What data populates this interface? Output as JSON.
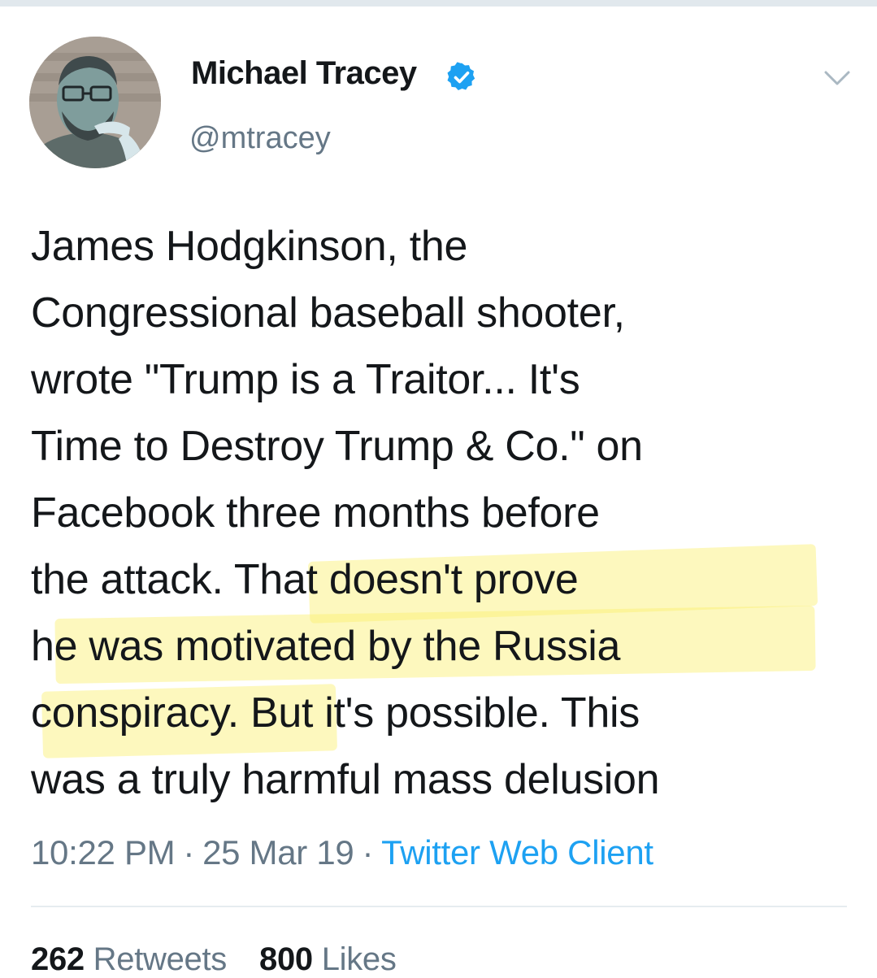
{
  "author": {
    "display_name": "Michael Tracey",
    "handle": "@mtracey",
    "verified": true,
    "verified_color": "#1da1f2"
  },
  "tweet": {
    "lines": [
      "James Hodgkinson, the",
      "Congressional baseball shooter,",
      "wrote \"Trump is a Traitor... It's",
      "Time to Destroy Trump & Co.\" on",
      "Facebook three months before",
      "the attack. That doesn't prove",
      "he was motivated by the Russia",
      "conspiracy. But it's possible. This",
      "was a truly harmful mass delusion"
    ],
    "highlight_color": "#faf06e"
  },
  "meta": {
    "time": "10:22 PM",
    "separator": "·",
    "date": "25 Mar 19",
    "source": "Twitter Web Client",
    "source_color": "#1da1f2"
  },
  "stats": {
    "retweets_count": "262",
    "retweets_label": "Retweets",
    "likes_count": "800",
    "likes_label": "Likes"
  },
  "icons": {
    "avatar": "avatar-illustration",
    "verified": "verified-badge-icon",
    "more": "chevron-down-icon"
  }
}
